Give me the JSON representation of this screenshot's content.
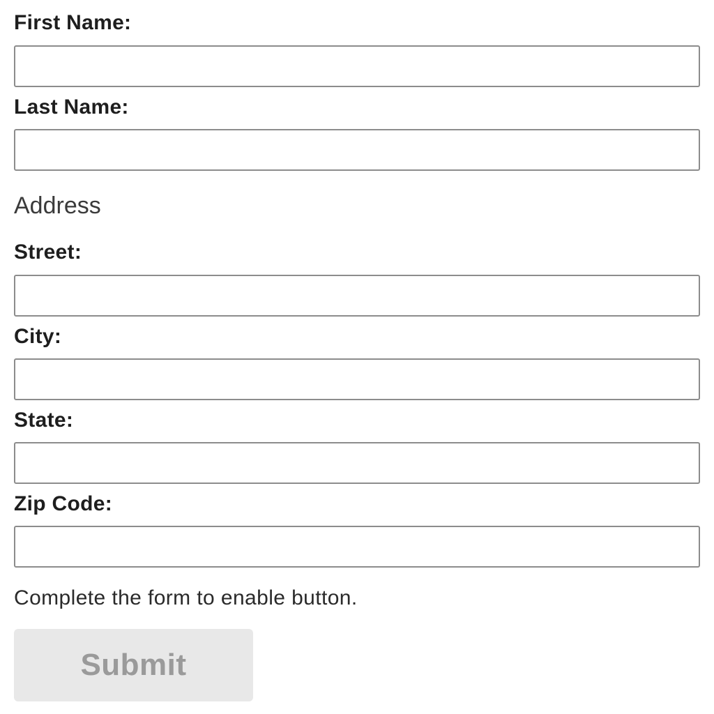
{
  "form": {
    "fields": {
      "first_name": {
        "label": "First Name:",
        "value": "",
        "placeholder": ""
      },
      "last_name": {
        "label": "Last Name:",
        "value": "",
        "placeholder": ""
      },
      "street": {
        "label": "Street:",
        "value": "",
        "placeholder": ""
      },
      "city": {
        "label": "City:",
        "value": "",
        "placeholder": ""
      },
      "state": {
        "label": "State:",
        "value": "",
        "placeholder": ""
      },
      "zip": {
        "label": "Zip Code:",
        "value": "",
        "placeholder": ""
      }
    },
    "address_heading": "Address",
    "hint": "Complete the form to enable button.",
    "submit": {
      "label": "Submit",
      "enabled": false
    }
  },
  "colors": {
    "label_text": "#1e1e1e",
    "field_border": "#8c8c8c",
    "button_bg_disabled": "#e8e8e8",
    "button_text_disabled": "#9a9a9a"
  }
}
